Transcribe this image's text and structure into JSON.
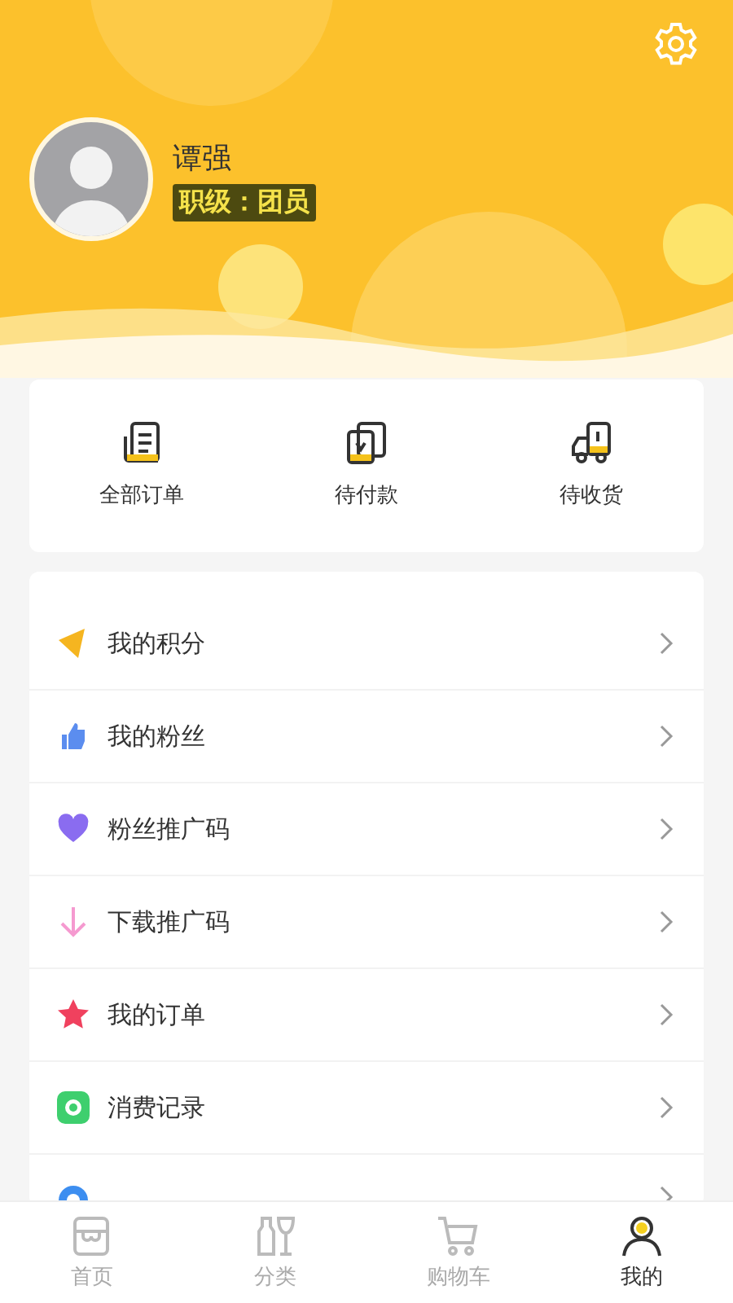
{
  "profile": {
    "name": "谭强",
    "level_badge": "职级：团员"
  },
  "order_shortcuts": [
    {
      "kind": "all",
      "label": "全部订单"
    },
    {
      "kind": "pay",
      "label": "待付款"
    },
    {
      "kind": "ship",
      "label": "待收货"
    }
  ],
  "menu": [
    {
      "kind": "diamond",
      "label": "我的积分",
      "color": "#f5b520"
    },
    {
      "kind": "thumb",
      "label": "我的粉丝",
      "color": "#5b8def"
    },
    {
      "kind": "heart",
      "label": "粉丝推广码",
      "color": "#8a6cf0"
    },
    {
      "kind": "down",
      "label": "下载推广码",
      "color": "#f59ad0"
    },
    {
      "kind": "star",
      "label": "我的订单",
      "color": "#f0415e"
    },
    {
      "kind": "record",
      "label": "消费记录",
      "color": "#3ecf6e"
    },
    {
      "kind": "pin",
      "color": "#3d8ef0"
    }
  ],
  "tab_bar": [
    {
      "kind": "home",
      "label": "首页",
      "selected": false
    },
    {
      "kind": "category",
      "label": "分类",
      "selected": false
    },
    {
      "kind": "cart",
      "label": "购物车",
      "selected": false
    },
    {
      "kind": "me",
      "label": "我的",
      "selected": true
    }
  ]
}
